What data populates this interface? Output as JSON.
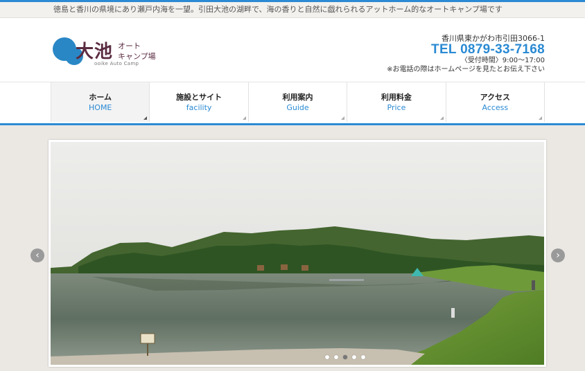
{
  "tagline": "徳島と香川の県境にあり瀬戸内海を一望。引田大池の湖畔で、海の香りと自然に戯れられるアットホーム的なオートキャンプ場です",
  "logo": {
    "main": "大池",
    "sub_line1": "オート",
    "sub_line2": "キャンプ場",
    "en": "ooike Auto Camp"
  },
  "contact": {
    "address": "香川県東かがわ市引田3066-1",
    "tel": "TEL 0879-33-7168",
    "hours": "〈受付時間〉9:00〜17:00",
    "note": "※お電話の際はホームページを見たとお伝え下さい"
  },
  "nav": {
    "items": [
      {
        "jp": "ホーム",
        "en": "HOME"
      },
      {
        "jp": "施設とサイト",
        "en": "facility"
      },
      {
        "jp": "利用案内",
        "en": "Guide"
      },
      {
        "jp": "利用料金",
        "en": "Price"
      },
      {
        "jp": "アクセス",
        "en": "Access"
      }
    ],
    "active_index": 0
  },
  "slider": {
    "prev_symbol": "‹",
    "next_symbol": "›",
    "slide_count": 5,
    "active_slide": 2,
    "photo_alt": "lake with forested hills and campsite"
  },
  "colors": {
    "accent": "#2a8ad3",
    "logo_blue": "#2a87c6",
    "logo_text": "#5a2b41"
  }
}
